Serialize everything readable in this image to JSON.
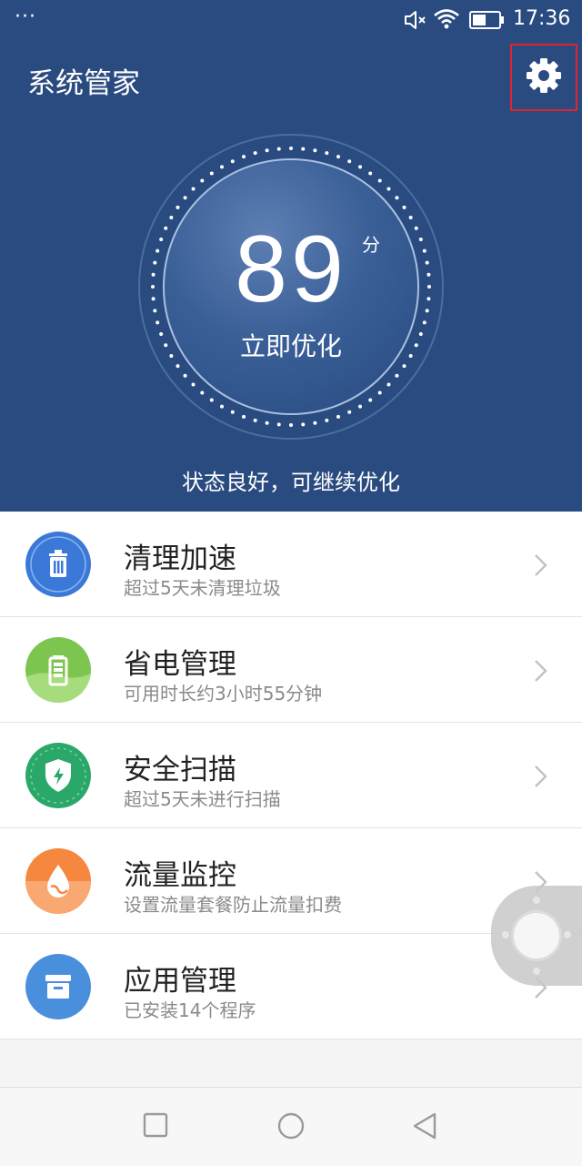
{
  "status_bar": {
    "dots": "···",
    "time": "17:36",
    "icons": [
      "mute-icon",
      "wifi-icon",
      "battery-icon"
    ]
  },
  "header": {
    "title": "系统管家",
    "settings_icon": "gear-icon",
    "background_color": "#2a4b80"
  },
  "score": {
    "value": "89",
    "unit": "分",
    "action_label": "立即优化",
    "status": "状态良好，可继续优化"
  },
  "items": [
    {
      "title": "清理加速",
      "subtitle": "超过5天未清理垃圾",
      "icon": "trash-icon",
      "color": "#3b79d8"
    },
    {
      "title": "省电管理",
      "subtitle": "可用时长约3小时55分钟",
      "icon": "battery-icon",
      "color": "#7cc54f"
    },
    {
      "title": "安全扫描",
      "subtitle": "超过5天未进行扫描",
      "icon": "shield-icon",
      "color": "#2aa86a"
    },
    {
      "title": "流量监控",
      "subtitle": "设置流量套餐防止流量扣费",
      "icon": "water-drop-icon",
      "color": "#f5873f"
    },
    {
      "title": "应用管理",
      "subtitle": "已安装14个程序",
      "icon": "app-box-icon",
      "color": "#4a8fdb"
    }
  ],
  "nav_bar": [
    "square-icon",
    "circle-icon",
    "back-triangle-icon"
  ]
}
